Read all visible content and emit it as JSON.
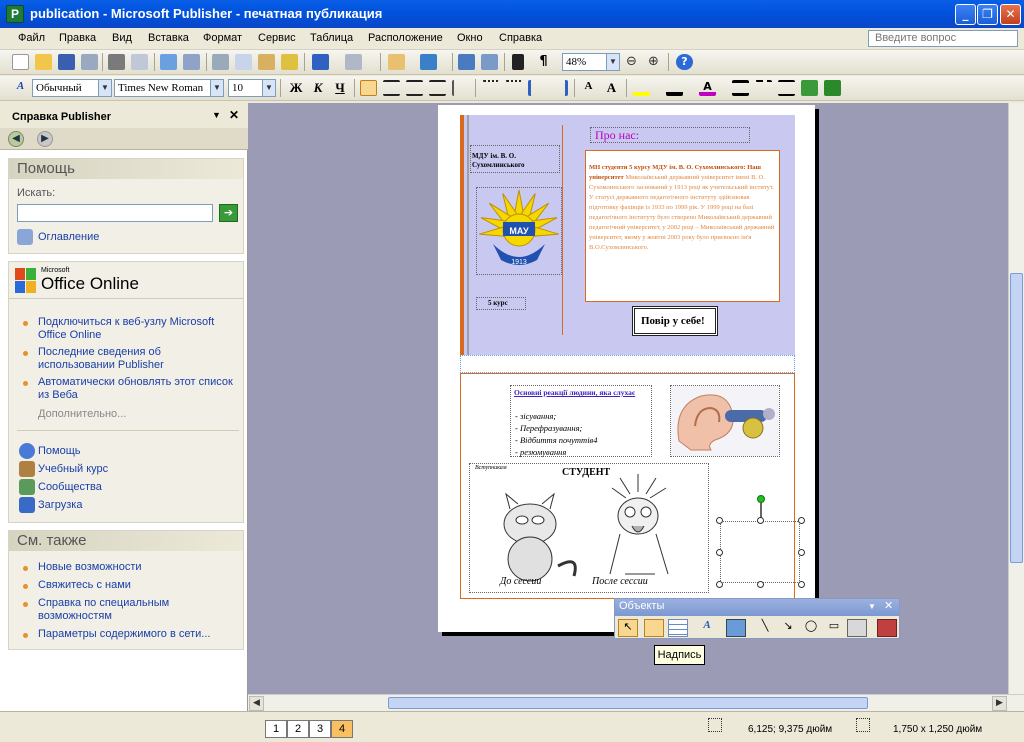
{
  "window": {
    "title": "publication - Microsoft Publisher - печатная публикация",
    "app_icon": "P"
  },
  "menu": {
    "items": [
      "Файл",
      "Правка",
      "Вид",
      "Вставка",
      "Формат",
      "Сервис",
      "Таблица",
      "Расположение",
      "Окно",
      "Справка"
    ],
    "help_placeholder": "Введите вопрос"
  },
  "toolbar": {
    "zoom": "48%"
  },
  "format_toolbar": {
    "style": "Обычный",
    "font": "Times New Roman",
    "size": "10",
    "bold": "Ж",
    "italic": "К",
    "underline": "Ч"
  },
  "taskpane": {
    "title": "Справка Publisher",
    "help": {
      "heading": "Помощь",
      "search_label": "Искать:",
      "search_value": "",
      "contents_link": "Оглавление"
    },
    "office_online": {
      "brand_small": "Microsoft",
      "brand": "Office Online",
      "links": [
        "Подключиться к веб-узлу Microsoft Office Online",
        "Последние сведения об использовании Publisher",
        "Автоматически обновлять этот список из Веба"
      ],
      "more": "Дополнительно..."
    },
    "resources": [
      "Помощь",
      "Учебный курс",
      "Сообщества",
      "Загрузка"
    ],
    "see_also": {
      "heading": "См. также",
      "links": [
        "Новые возможности",
        "Свяжитесь с нами",
        "Справка по специальным возможностям",
        "Параметры содержимого в сети..."
      ]
    }
  },
  "publication": {
    "about_title": "Про нас:",
    "uni_label": "МДУ ім. В. О. Сухомлинського",
    "logo_text": "МАУ",
    "logo_year": "1913",
    "course": "5 курс",
    "about_bold": "МН студенти 5 курсу МДУ ім. В. О. Сухомлинського: Наш університет",
    "about_body": "Миколаївський державний університет імені В. О. Сухомлинського заснований у 1913 році як учительський інститут. У статусі державного педагогічного інституту здійснював підготовку фахівців із 1933 по 1999 рік. У 1999 році на базі педагогічного інституту було створено Миколаївський державний педагогічний університет, у 2002 році – Миколаївський державний університет, якому у жовтні 2003 року було присвоєно ім'я В.О.Сухомлинського.",
    "check_button": "Повір у себе!",
    "list_title": "Основні реакції людини, яка слухає",
    "list_items": [
      "зісування;",
      "Перефразування;",
      "Відбиття почуттів4",
      "резюмування"
    ],
    "cartoon_corner": "Вступникам",
    "cartoon_title": "СТУДЕНТ",
    "cartoon_before": "До сессии",
    "cartoon_after": "После сессии"
  },
  "objects_toolbar": {
    "title": "Объекты",
    "tooltip": "Надпись"
  },
  "status": {
    "pages": [
      "1",
      "2",
      "3",
      "4"
    ],
    "active_page": "4",
    "position": "6,125; 9,375 дюйм",
    "size": "1,750 x 1,250 дюйм"
  }
}
